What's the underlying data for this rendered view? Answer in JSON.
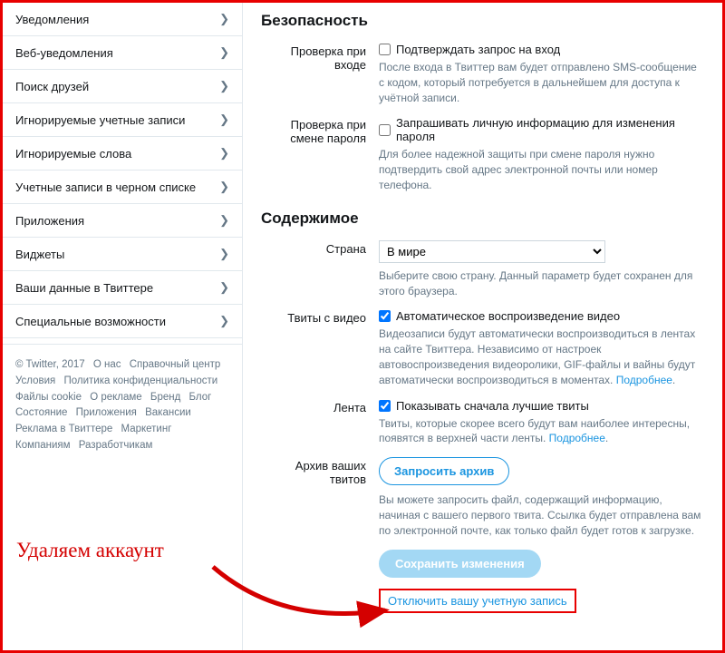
{
  "sidebar": {
    "items": [
      {
        "label": "Уведомления"
      },
      {
        "label": "Веб-уведомления"
      },
      {
        "label": "Поиск друзей"
      },
      {
        "label": "Игнорируемые учетные записи"
      },
      {
        "label": "Игнорируемые слова"
      },
      {
        "label": "Учетные записи в черном списке"
      },
      {
        "label": "Приложения"
      },
      {
        "label": "Виджеты"
      },
      {
        "label": "Ваши данные в Твиттере"
      },
      {
        "label": "Специальные возможности"
      }
    ]
  },
  "footer": {
    "copyright": "© Twitter, 2017",
    "links": [
      "О нас",
      "Справочный центр",
      "Условия",
      "Политика конфиденциальности",
      "Файлы cookie",
      "О рекламе",
      "Бренд",
      "Блог",
      "Состояние",
      "Приложения",
      "Вакансии",
      "Реклама в Твиттере",
      "Маркетинг",
      "Компаниям",
      "Разработчикам"
    ]
  },
  "security": {
    "heading": "Безопасность",
    "login": {
      "label": "Проверка при входе",
      "checkbox_label": "Подтверждать запрос на вход",
      "help": "После входа в Твиттер вам будет отправлено SMS-сообщение с кодом, который потребуется в дальнейшем для доступа к учётной записи."
    },
    "password": {
      "label": "Проверка при смене пароля",
      "checkbox_label": "Запрашивать личную информацию для изменения пароля",
      "help": "Для более надежной защиты при смене пароля нужно подтвердить свой адрес электронной почты или номер телефона."
    }
  },
  "content": {
    "heading": "Содержимое",
    "country": {
      "label": "Страна",
      "selected": "В мире",
      "help": "Выберите свою страну. Данный параметр будет сохранен для этого браузера."
    },
    "video": {
      "label": "Твиты с видео",
      "checkbox_label": "Автоматическое воспроизведение видео",
      "help_pre": "Видеозаписи будут автоматически воспроизводиться в лентах на сайте Твиттера. Независимо от настроек автовоспроизведения видеоролики, GIF-файлы и вайны будут автоматически воспроизводиться в моментах. ",
      "help_link": "Подробнее"
    },
    "timeline": {
      "label": "Лента",
      "checkbox_label": "Показывать сначала лучшие твиты",
      "help_pre": "Твиты, которые скорее всего будут вам наиболее интересны, появятся в верхней части ленты. ",
      "help_link": "Подробнее"
    },
    "archive": {
      "label": "Архив ваших твитов",
      "button": "Запросить архив",
      "help": "Вы можете запросить файл, содержащий информацию, начиная с вашего первого твита. Ссылка будет отправлена вам по электронной почте, как только файл будет готов к загрузке."
    },
    "save": "Сохранить изменения",
    "deactivate": "Отключить вашу учетную запись"
  },
  "annotation": "Удаляем аккаунт"
}
